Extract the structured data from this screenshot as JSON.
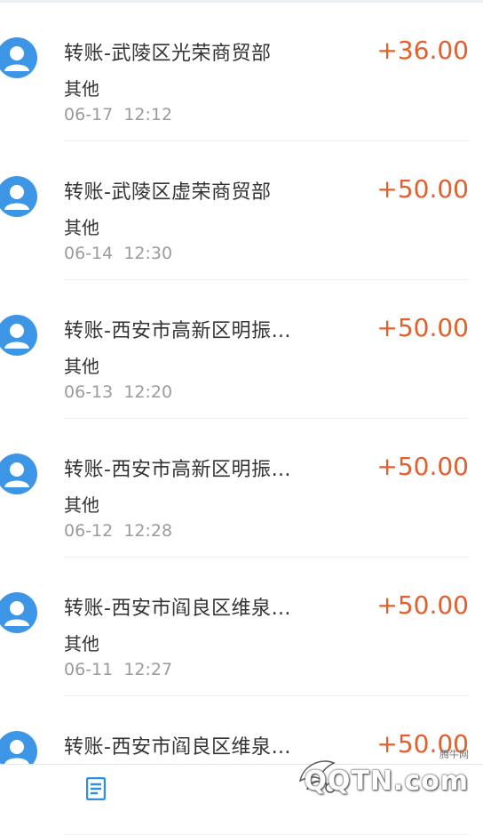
{
  "colors": {
    "amount": "#e0602e",
    "avatar": "#3d95e6",
    "title": "#333333",
    "datetime": "#9b9b9b",
    "tab_icon": "#2b8fe8"
  },
  "transactions": [
    {
      "title": "转账-武陵区光荣商贸部",
      "category": "其他",
      "date": "06-17",
      "time": "12:12",
      "amount": "+36.00",
      "icon": "user-avatar-icon"
    },
    {
      "title": "转账-武陵区虚荣商贸部",
      "category": "其他",
      "date": "06-14",
      "time": "12:30",
      "amount": "+50.00",
      "icon": "user-avatar-icon"
    },
    {
      "title": "转账-西安市高新区明振…",
      "category": "其他",
      "date": "06-13",
      "time": "12:20",
      "amount": "+50.00",
      "icon": "user-avatar-icon"
    },
    {
      "title": "转账-西安市高新区明振…",
      "category": "其他",
      "date": "06-12",
      "time": "12:28",
      "amount": "+50.00",
      "icon": "user-avatar-icon"
    },
    {
      "title": "转账-西安市阎良区维泉…",
      "category": "其他",
      "date": "06-11",
      "time": "12:27",
      "amount": "+50.00",
      "icon": "user-avatar-icon"
    },
    {
      "title": "转账-西安市阎良区维泉…",
      "category": "",
      "date": "",
      "time": "",
      "amount": "+50.00",
      "icon": "user-avatar-icon"
    }
  ],
  "bottom_bar": {
    "icon": "bill-list-icon"
  },
  "watermark": {
    "small_text": "腾牛网",
    "big_text": "QQTN.com"
  }
}
